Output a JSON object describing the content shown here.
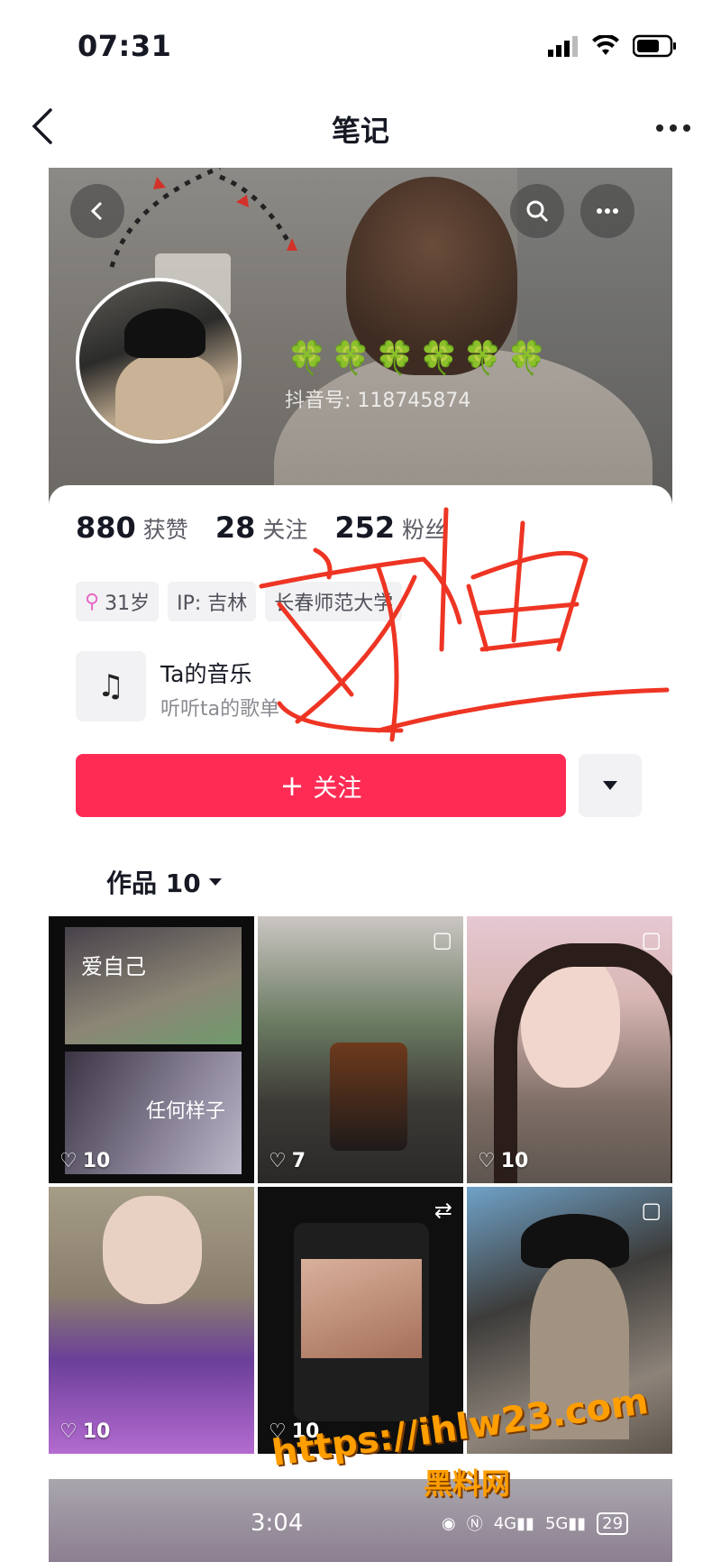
{
  "status_bar": {
    "time": "07:31"
  },
  "nav": {
    "title": "笔记"
  },
  "profile": {
    "clovers": "🍀🍀🍀🍀🍀🍀",
    "douyin_id": "抖音号: 118745874",
    "stats": [
      {
        "value": "880",
        "label": "获赞"
      },
      {
        "value": "28",
        "label": "关注"
      },
      {
        "value": "252",
        "label": "粉丝"
      }
    ],
    "tags": {
      "age": "31岁",
      "ip": "IP: 吉林",
      "school": "长春师范大学"
    },
    "music": {
      "title": "Ta的音乐",
      "subtitle": "听听ta的歌单"
    },
    "follow_label": "关注",
    "handwritten_name": "刘迪"
  },
  "works": {
    "title": "作品 10",
    "items": [
      {
        "likes": "10"
      },
      {
        "likes": "7"
      },
      {
        "likes": "10"
      },
      {
        "likes": "10"
      },
      {
        "likes": "10"
      },
      {
        "likes": ""
      }
    ],
    "item1_texts": {
      "top": "爱自己",
      "bottom": "任何样子"
    }
  },
  "bottom_strip": {
    "time": "3:04",
    "battery": "29"
  },
  "watermark": {
    "url": "https://ihlw23.com",
    "site": "黑料网"
  },
  "colors": {
    "accent": "#fe2c55",
    "handwriting": "#ee3524",
    "watermark": "#ff9e00"
  }
}
